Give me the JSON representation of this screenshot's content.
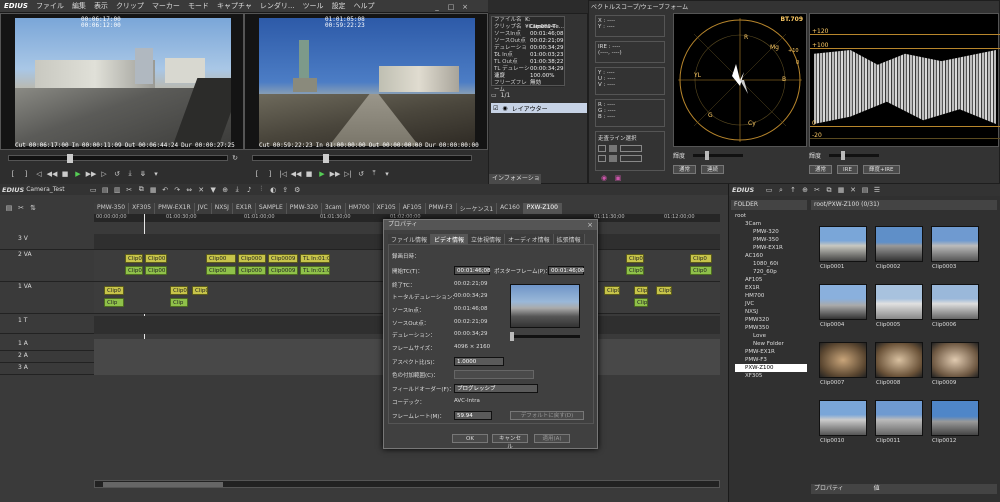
{
  "menubar": {
    "logo": "EDIUS",
    "items": [
      "ファイル",
      "編集",
      "表示",
      "クリップ",
      "マーカー",
      "モード",
      "キャプチャ",
      "レンダリ...",
      "ツール",
      "設定",
      "ヘルプ"
    ]
  },
  "player": {
    "tc_top1": "00:06:17:00",
    "tc_top2": "00:06:12:00",
    "cut": "Cut",
    "cut_tc": "00:06:17:00",
    "in": "In",
    "in_tc": "00:00:11:09",
    "out": "Out",
    "out_tc": "00:06:44:24",
    "dur": "Dur",
    "dur_tc": "00:00:27:25"
  },
  "recorder": {
    "tc_top1": "01:01:05:08",
    "tc_top2": "00:59:22:23",
    "cut": "Cut",
    "cut_tc": "00:59:22:23",
    "in": "In",
    "in_tc": "01:00:00:00",
    "out": "Out",
    "out_tc": "00:00:00:00",
    "dur": "Dur",
    "dur_tc": "00:00:00:00"
  },
  "info": {
    "rows": [
      [
        "ファイル名",
        "K:¥Camera_Te..."
      ],
      [
        "クリップ名",
        "Clip0004"
      ],
      [
        "ソースIn点",
        "00:01:46;08"
      ],
      [
        "ソースOut点",
        "00:02:21;09"
      ],
      [
        "デュレーション",
        "00:00:34;29"
      ],
      [
        "TL In点",
        "01:00:03;23"
      ],
      [
        "TL Out点",
        "01:00:38;22"
      ],
      [
        "TL デュレーション",
        "00:00:34;29"
      ],
      [
        "速度",
        "100.00%"
      ],
      [
        "フリーズフレーム",
        "無効"
      ]
    ],
    "page": "1/1",
    "layer_label": "レイアウター",
    "tab": "インフォメーション"
  },
  "scope": {
    "title": "ベクトルスコープ/ウェーブフォーム",
    "x_label": "X : ----",
    "y_label": "Y : ----",
    "ire_label": "IRE : ----",
    "ire_sub": "(----, ----)",
    "v1": "Y : ----",
    "v2": "U : ----",
    "v3": "V : ----",
    "r": "R : ----",
    "g": "G : ----",
    "b": "B : ----",
    "line_title": "走査ライン選択",
    "bt": "BT.709",
    "wf_120": "+120",
    "wf_100": "+100",
    "wf_0": "0",
    "wf_m20": "-20",
    "brightness": "輝度",
    "btn_normal": "通常",
    "btn_continuous": "連続",
    "btn_normal2": "通常",
    "btn_ire": "IRE",
    "btn_ireplus": "輝度+IRE",
    "markers": {
      "r": "R",
      "mg": "Mg",
      "b": "B",
      "cy": "Cy",
      "g": "G",
      "yl": "YL",
      "ten": "+10",
      "zero": "0",
      "m10": "-10"
    }
  },
  "timeline": {
    "project": "EDIUS",
    "project_name": "Camera_Test",
    "tabs": [
      "PMW-350",
      "XF305",
      "PMW-EX1R",
      "JVC",
      "NXSJ",
      "EX1R",
      "SAMPLE",
      "PMW-320",
      "3cam",
      "HM700",
      "XF105",
      "AF105",
      "PMW-F3",
      "シーケンス1",
      "AC160",
      "PXW-Z100"
    ],
    "active_tab": "PXW-Z100",
    "ruler": [
      "00:00:00;00",
      "01:00:30;00",
      "01:01:00;00",
      "01:01:30;00",
      "01:02:00;00",
      "01:11:30;00",
      "01:12:00;00"
    ],
    "tracks": [
      {
        "name": "3 V"
      },
      {
        "name": "2 VA"
      },
      {
        "name": "1 VA"
      },
      {
        "name": "1 T"
      },
      {
        "name": "1 A"
      },
      {
        "name": "2 A"
      },
      {
        "name": "3 A"
      }
    ],
    "clips_row1": [
      "Clip0",
      "Clip00",
      "Clip00",
      "Clip000",
      "Clip0009",
      "TL In:01:0...",
      "Clip0",
      "Clip0"
    ],
    "clips_row2": [
      "Clip0",
      "Clip00",
      "Clip00",
      "Clip000",
      "Clip0009",
      "TL In:01:0...",
      "Clip0",
      "Clip0"
    ],
    "clips_row3": [
      "Clip0",
      "Clip0",
      "Clip0",
      "Clip0",
      "Clip",
      "Clip0",
      "Clip",
      "Clip",
      "Clip"
    ]
  },
  "dialog": {
    "title": "プロパティ",
    "tabs": [
      "ファイル情報",
      "ビデオ情報",
      "立体視情報",
      "オーディオ情報",
      "拡張情報"
    ],
    "active_tab": "ビデオ情報",
    "fields": {
      "rec_date": "録画日時：",
      "start_tc_label": "開始TC(T)：",
      "start_tc": "00:01:46;08",
      "poster_label": "ポスターフレーム(P)：",
      "poster": "00:01:46;08",
      "end_tc_label": "終了TC：",
      "end_tc": "00:02:21;09",
      "total_dur_label": "トータルデュレーション：",
      "total_dur": "00:00:34;29",
      "src_in_label": "ソースIn点：",
      "src_in": "00:01:46;08",
      "src_out_label": "ソースOut点：",
      "src_out": "00:02:21;09",
      "dur_label": "デュレーション：",
      "dur": "00:00:34;29",
      "frame_size_label": "フレームサイズ：",
      "frame_size": "4096 × 2160",
      "aspect_label": "アスペクト比(S)：",
      "aspect": "1.0000",
      "color_label": "色の付加範囲(C)：",
      "field_label": "フィールドオーダー(F)：",
      "field": "プログレッシブ",
      "codec_label": "コーデック：",
      "codec": "AVC-Intra",
      "fps_label": "フレームレート(M)：",
      "fps": "59.94",
      "default_btn": "デフォルトに戻す(D)"
    },
    "ok": "OK",
    "cancel": "キャンセル",
    "apply": "適用(A)"
  },
  "bin": {
    "title": "EDIUS",
    "folder": "FOLDER",
    "path": "root/PXW-Z100 (0/31)",
    "tree": [
      "root",
      "3Cam",
      "PMW-320",
      "PMW-350",
      "PMW-EX1R",
      "AC160",
      "1080_60i",
      "720_60p",
      "AF105",
      "EX1R",
      "HM700",
      "JVC",
      "NXSJ",
      "PMW320",
      "PMW350",
      "Love",
      "New Folder",
      "PMW-EX1R",
      "PMW-F3",
      "PXW-Z100",
      "XF305"
    ],
    "clips": [
      "Clip0001",
      "Clip0002",
      "Clip0003",
      "Clip0004",
      "Clip0005",
      "Clip0006",
      "Clip0007",
      "Clip0008",
      "Clip0009",
      "Clip0010",
      "Clip0011",
      "Clip0012"
    ],
    "property": "プロパティ",
    "property_tab": "値"
  }
}
